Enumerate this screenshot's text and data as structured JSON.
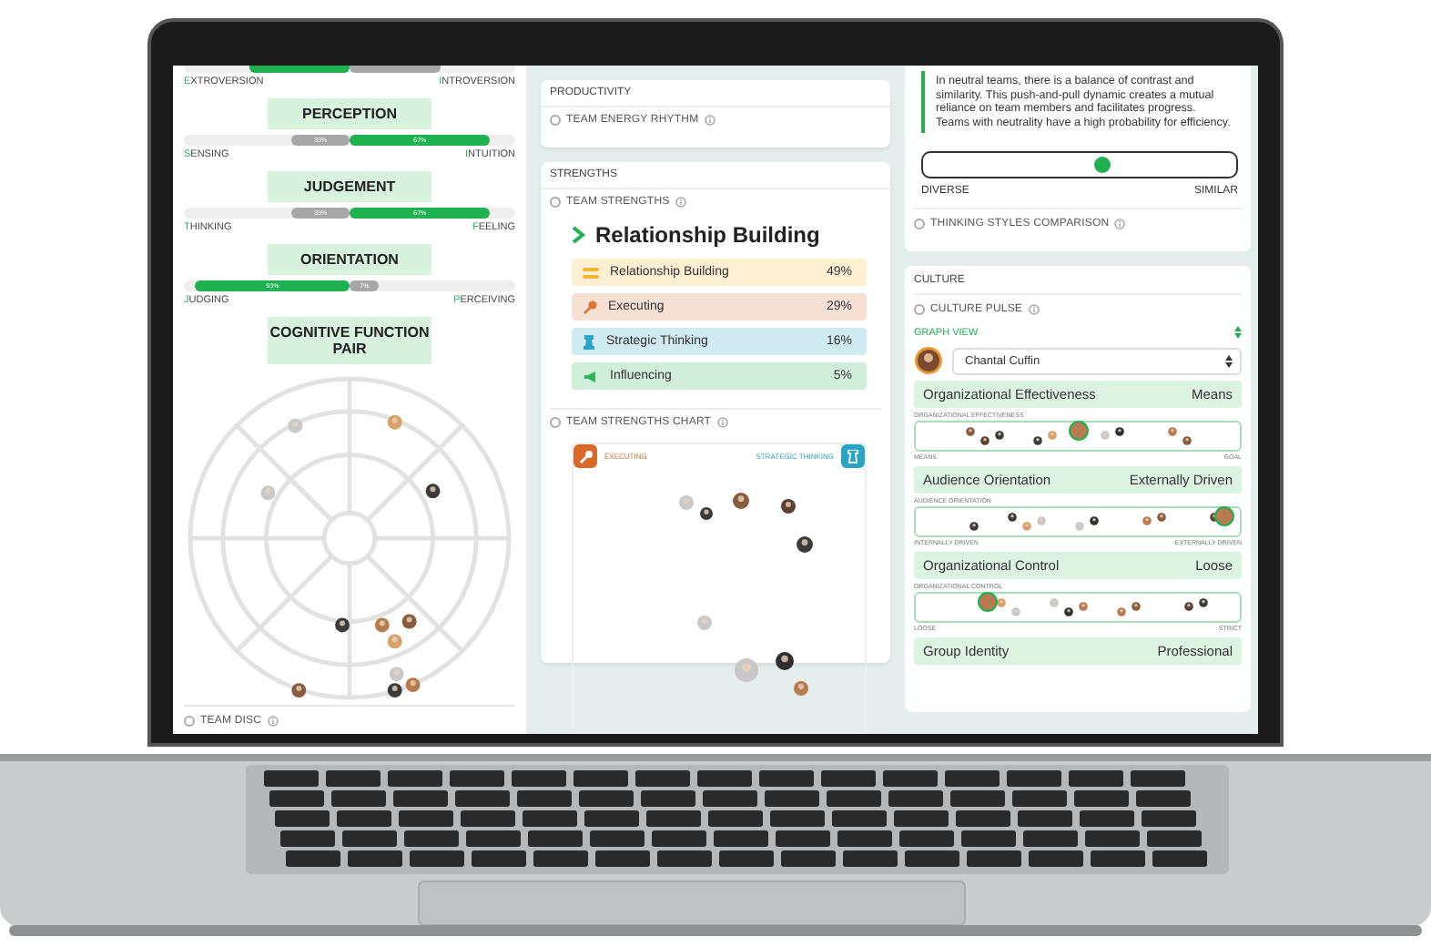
{
  "left_panel": {
    "scales": [
      {
        "left": {
          "label": "EXTROVERSION",
          "level": 0.6,
          "selected": true
        },
        "right": {
          "label": "INTROVERSION",
          "level": 0.55,
          "selected": false
        }
      },
      {
        "heading": "PERCEPTION",
        "left": {
          "label": "SENSING",
          "reading": "33%",
          "level": 0.35,
          "selected": false
        },
        "right": {
          "label": "INTUITION",
          "reading": "67%",
          "level": 0.85,
          "selected": true
        }
      },
      {
        "heading": "JUDGEMENT",
        "left": {
          "label": "THINKING",
          "reading": "33%",
          "level": 0.35,
          "selected": false
        },
        "right": {
          "label": "FEELING",
          "reading": "67%",
          "level": 0.85,
          "selected": true
        }
      },
      {
        "heading": "ORIENTATION",
        "left": {
          "label": "JUDGING",
          "reading": "93%",
          "level": 0.93,
          "selected": true
        },
        "right": {
          "label": "PERCEIVING",
          "reading": "7%",
          "level": 0.18,
          "selected": false
        }
      }
    ],
    "cognitive_heading": "COGNITIVE FUNCTION PAIR",
    "footer": "TEAM DISC"
  },
  "middle_panel": {
    "productivity": {
      "title": "PRODUCTIVITY",
      "section": "TEAM ENERGY RHYTHM"
    },
    "strengths": {
      "title": "STRENGTHS",
      "section": "TEAM STRENGTHS",
      "top": "Relationship Building",
      "items": [
        {
          "kind": "relationship",
          "label": "Relationship Building",
          "reading": "49%",
          "color": "#f2b632"
        },
        {
          "kind": "executing",
          "label": "Executing",
          "reading": "29%",
          "color": "#d9773a"
        },
        {
          "kind": "strategic",
          "label": "Strategic Thinking",
          "reading": "16%",
          "color": "#2aa3c4"
        },
        {
          "kind": "influencing",
          "label": "Influencing",
          "reading": "5%",
          "color": "#2fb35a"
        }
      ],
      "chart_section": "TEAM STRENGTHS CHART",
      "chart_left": "EXECUTING",
      "chart_right": "STRATEGIC THINKING"
    }
  },
  "right_panel": {
    "description": "In neutral teams, there is a balance of contrast and similarity. This push-and-pull dynamic creates a mutual reliance on team members and facilitates progress. Teams with neutrality have a high probability for efficiency.",
    "slider": {
      "level": 0.57,
      "left": "DIVERSE",
      "right": "SIMILAR"
    },
    "section": "THINKING STYLES COMPARISON",
    "culture": {
      "title": "CULTURE",
      "section": "CULTURE PULSE",
      "view": "GRAPH VIEW",
      "person": "Chantal Cuffin",
      "rows": [
        {
          "title": "Organizational Effectiveness",
          "value": "Means",
          "axis": "ORGANIZATIONAL EFFECTIVENESS",
          "left": "MEANS",
          "right": "GOAL",
          "level": 0.5
        },
        {
          "title": "Audience Orientation",
          "value": "Externally Driven",
          "axis": "AUDIENCE ORIENTATION",
          "left": "INTERNALLY DRIVEN",
          "right": "EXTERNALLY DRIVEN",
          "level": 0.98
        },
        {
          "title": "Organizational Control",
          "value": "Loose",
          "axis": "ORGANIZATIONAL CONTROL",
          "left": "LOOSE",
          "right": "STRICT",
          "level": 0.22
        },
        {
          "title": "Group Identity",
          "value": "Professional"
        }
      ]
    }
  }
}
